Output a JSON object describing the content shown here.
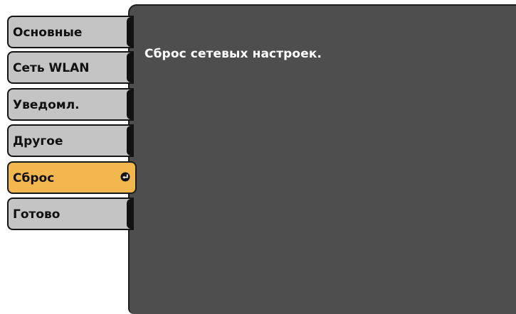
{
  "menu": {
    "items": [
      {
        "label": "Основные"
      },
      {
        "label": "Сеть WLAN"
      },
      {
        "label": "Уведомл."
      },
      {
        "label": "Другое"
      },
      {
        "label": "Сброс",
        "selected": true,
        "icon": "enter-icon"
      },
      {
        "label": "Готово"
      }
    ]
  },
  "panel": {
    "message": "Сброс сетевых настроек."
  },
  "colors": {
    "panel_bg": "#4e4e4f",
    "menu_item_bg": "#c4c4c4",
    "menu_item_selected_bg": "#f2b84f"
  }
}
